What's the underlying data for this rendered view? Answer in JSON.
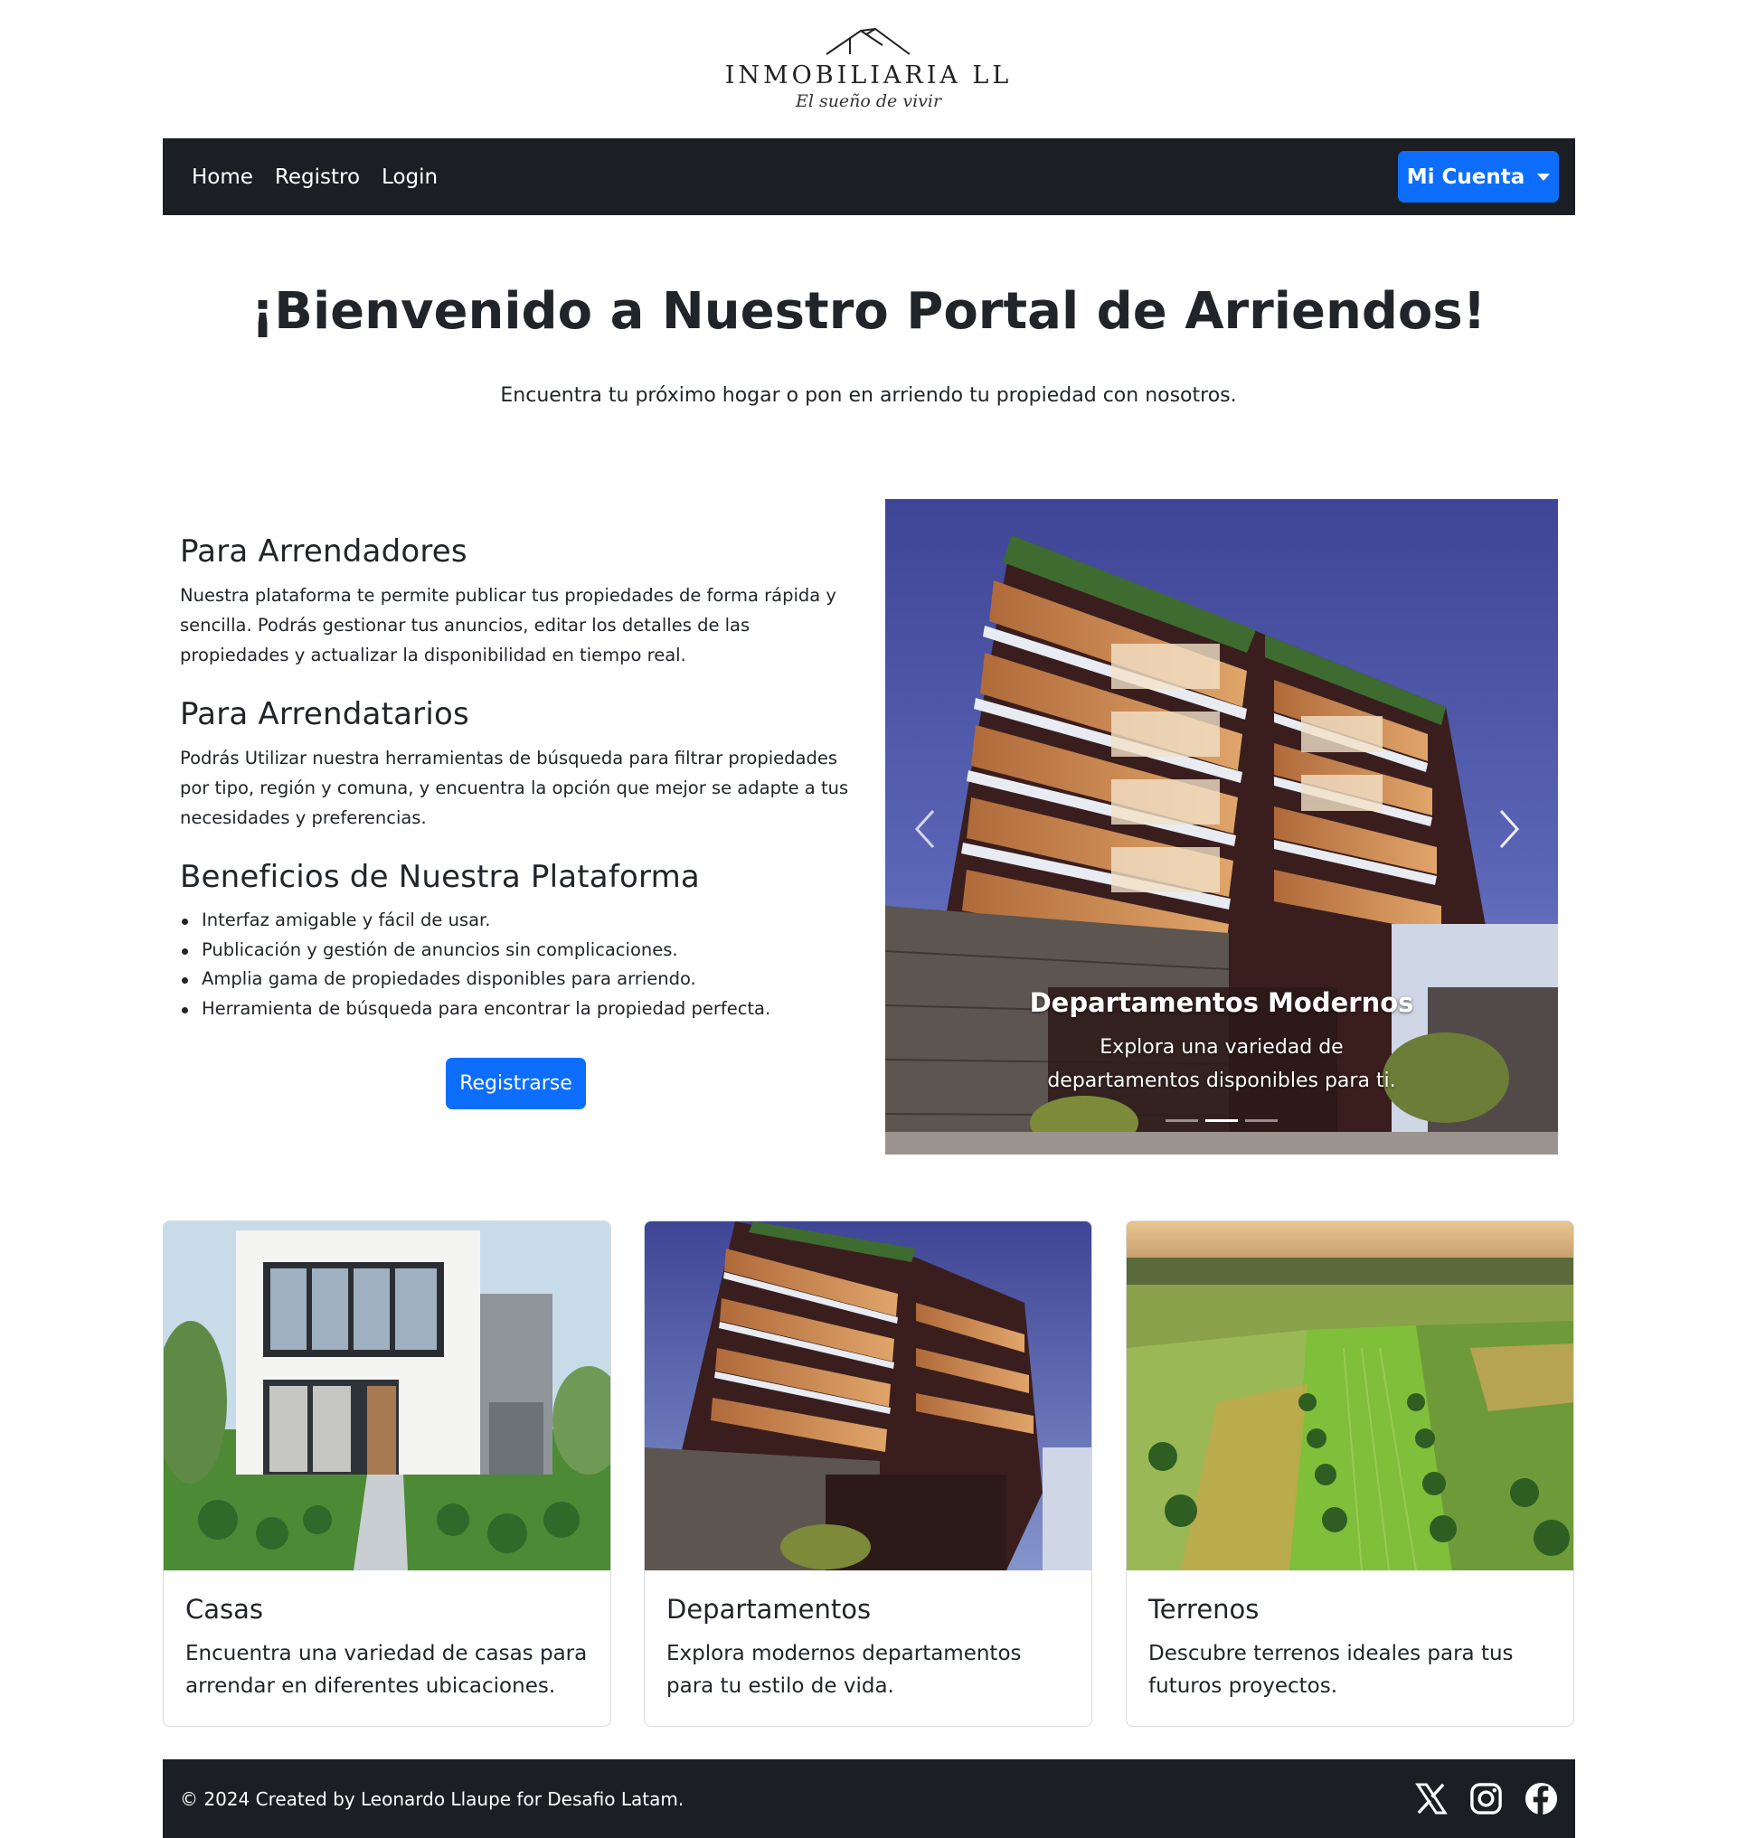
{
  "logo": {
    "brand": "INMOBILIARIA LL",
    "tagline": "El sueño de vivir"
  },
  "nav": {
    "links": [
      "Home",
      "Registro",
      "Login"
    ],
    "account_label": "Mi Cuenta"
  },
  "hero": {
    "title": "¡Bienvenido a Nuestro Portal de Arriendos!",
    "subtitle": "Encuentra tu próximo hogar o pon en arriendo tu propiedad con nosotros."
  },
  "info": {
    "landlords_title": "Para Arrendadores",
    "landlords_text": "Nuestra plataforma te permite publicar tus propiedades de forma rápida y sencilla. Podrás gestionar tus anuncios, editar los detalles de las propiedades y actualizar la disponibilidad en tiempo real.",
    "tenants_title": "Para Arrendatarios",
    "tenants_text": "Podrás Utilizar nuestra herramientas de búsqueda para filtrar propiedades por tipo, región y comuna, y encuentra la opción que mejor se adapte a tus necesidades y preferencias.",
    "benefits_title": "Beneficios de Nuestra Plataforma",
    "benefits": [
      "Interfaz amigable y fácil de usar.",
      "Publicación y gestión de anuncios sin complicaciones.",
      "Amplia gama de propiedades disponibles para arriendo.",
      "Herramienta de búsqueda para encontrar la propiedad perfecta."
    ],
    "register_label": "Registrarse"
  },
  "carousel": {
    "caption_title": "Departamentos Modernos",
    "caption_text": "Explora una variedad de departamentos disponibles para ti.",
    "slide_count": 3,
    "active_slide": 2
  },
  "cards": [
    {
      "title": "Casas",
      "text": "Encuentra una variedad de casas para arrendar en diferentes ubicaciones."
    },
    {
      "title": "Departamentos",
      "text": "Explora modernos departamentos para tu estilo de vida."
    },
    {
      "title": "Terrenos",
      "text": "Descubre terrenos ideales para tus futuros proyectos."
    }
  ],
  "footer": {
    "text": "© 2024 Created by Leonardo Llaupe for Desafio Latam.",
    "socials": [
      "x-icon",
      "instagram-icon",
      "facebook-icon"
    ]
  },
  "colors": {
    "primary": "#0d6efd",
    "dark": "#1b1f23"
  }
}
